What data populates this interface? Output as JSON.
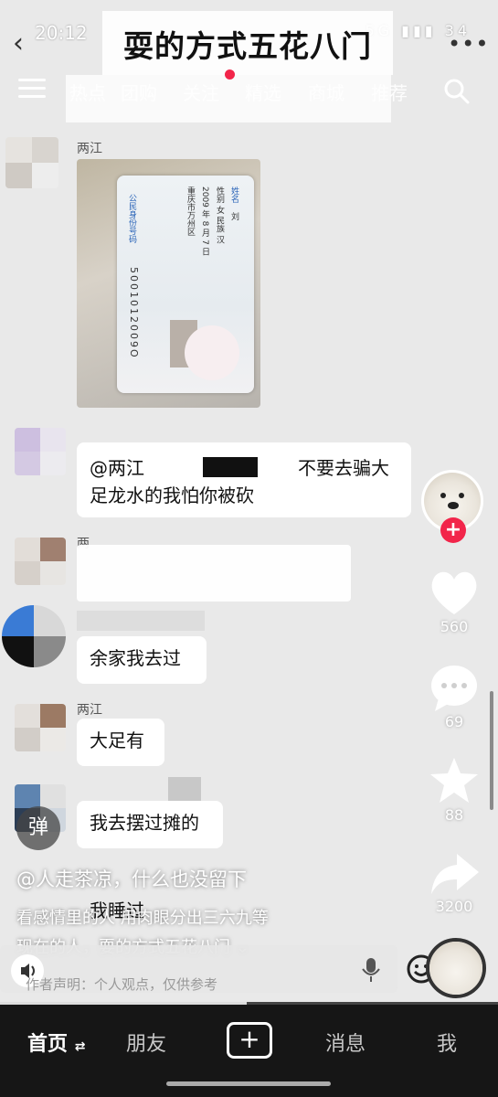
{
  "status": {
    "time": "20:12",
    "icons": "5G ▮▮▮ 34"
  },
  "title": "耍的方式五花八门",
  "tabs": [
    {
      "label": "热点"
    },
    {
      "label": "团购"
    },
    {
      "label": "关注"
    },
    {
      "label": "精选"
    },
    {
      "label": "商城"
    },
    {
      "label": "推荐"
    }
  ],
  "chat": {
    "sender1": "两江",
    "card_name_label": "姓名",
    "card_name": "刘",
    "card_gender": "性别 女 民族 汉",
    "card_birth": "2009 年 8 月 7 日",
    "card_addr": "重庆市万州区",
    "card_side_label": "公民身份号码",
    "card_number": "5001012009O",
    "msg2_prefix": "@两江",
    "msg2_suffix": "不要去骗大",
    "msg2_line2": "足龙水的我怕你被砍",
    "sender3": "两",
    "msg4": "余家我去过",
    "sender5": "两江",
    "msg5": "大足有",
    "msg6": "我去摆过摊的",
    "msg7": "我睡过"
  },
  "rail": {
    "likes": "560",
    "comments": "69",
    "favorites": "88",
    "shares": "3200"
  },
  "danmu": "弹",
  "caption": {
    "author": "@人走茶凉，什么也没留下",
    "line1": "看感情里的人 用肉眼分出三六九等",
    "line2": "现在的人，耍的方式五花八门 ⌄"
  },
  "disclaimer": "作者声明：个人观点，仅供参考",
  "nav": {
    "home": "首页",
    "friends": "朋友",
    "messages": "消息",
    "me": "我"
  }
}
